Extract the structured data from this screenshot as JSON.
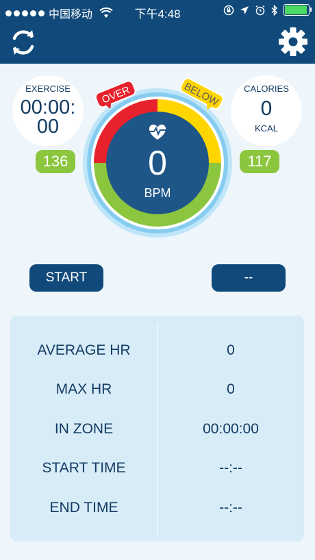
{
  "status_bar": {
    "carrier": "中国移动",
    "time": "下午4:48"
  },
  "exercise": {
    "label": "EXERCISE",
    "time_line1": "00:00:",
    "time_line2": "00",
    "zone_value": "136"
  },
  "calories": {
    "label": "CALORIES",
    "value": "0",
    "unit": "KCAL",
    "zone_value": "117"
  },
  "gauge": {
    "over_label": "OVER",
    "below_label": "BELOW",
    "bpm_value": "0",
    "bpm_unit": "BPM",
    "colors": {
      "over": "#e8222c",
      "below": "#ffd500",
      "zone": "#8cc63f",
      "ring": "#86ccf1",
      "center": "#1f5688"
    }
  },
  "buttons": {
    "start": "START",
    "mode": "--"
  },
  "stats": [
    {
      "label": "AVERAGE HR",
      "value": "0"
    },
    {
      "label": "MAX HR",
      "value": "0"
    },
    {
      "label": "IN ZONE",
      "value": "00:00:00"
    },
    {
      "label": "START TIME",
      "value": "--:--"
    },
    {
      "label": "END TIME",
      "value": "--:--"
    }
  ],
  "theme": {
    "header": "#114a7a",
    "text": "#123b63",
    "pill": "#8cc63f",
    "panel": "#d8ecf8"
  }
}
